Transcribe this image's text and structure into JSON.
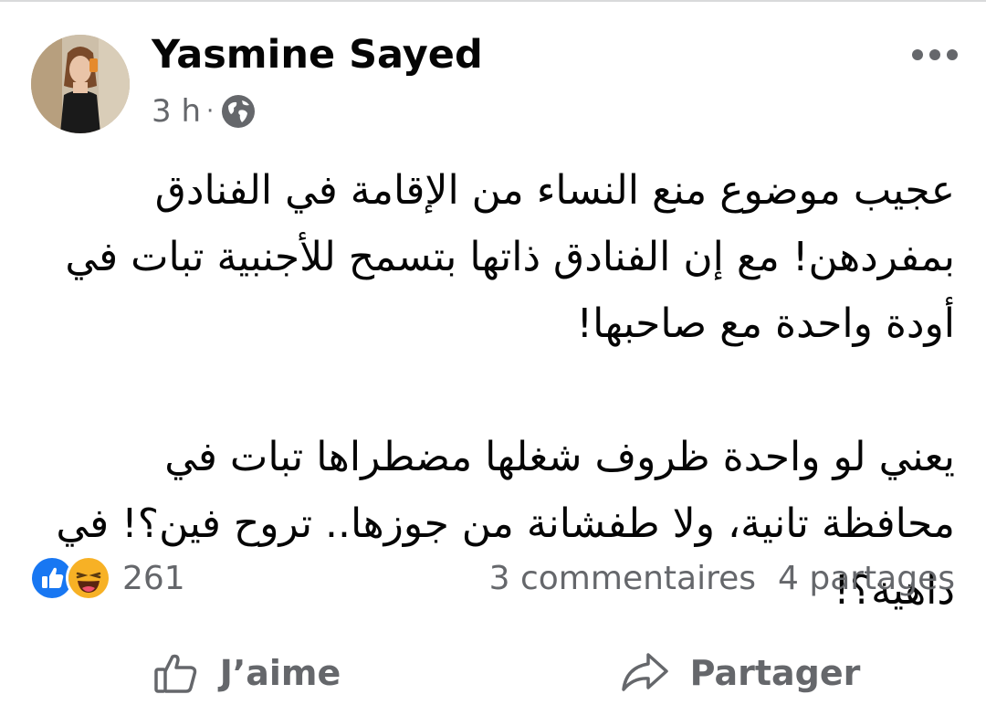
{
  "post": {
    "author": "Yasmine Sayed",
    "time": "3 h",
    "separator": "·",
    "audience_icon": "globe-icon",
    "paragraphs": [
      "عجيب موضوع منع النساء من الإقامة في الفنادق بمفردهن! مع إن الفنادق ذاتها بتسمح للأجنبية تبات في أودة واحدة مع صاحبها!",
      "يعني لو واحدة ظروف شغلها مضطراها تبات في محافظة تانية، ولا طفشانة من جوزها.. تروح فين؟! في داهية؟!"
    ]
  },
  "reactions": {
    "icons": [
      "like-icon",
      "haha-icon"
    ],
    "count": "261",
    "comments": "3 commentaires",
    "shares": "4 partages"
  },
  "actions": {
    "like_label": "J’aime",
    "share_label": "Partager"
  },
  "colors": {
    "text_primary": "#050505",
    "text_secondary": "#65676b",
    "like_blue": "#1877f2",
    "haha_yellow": "#f7b125"
  }
}
